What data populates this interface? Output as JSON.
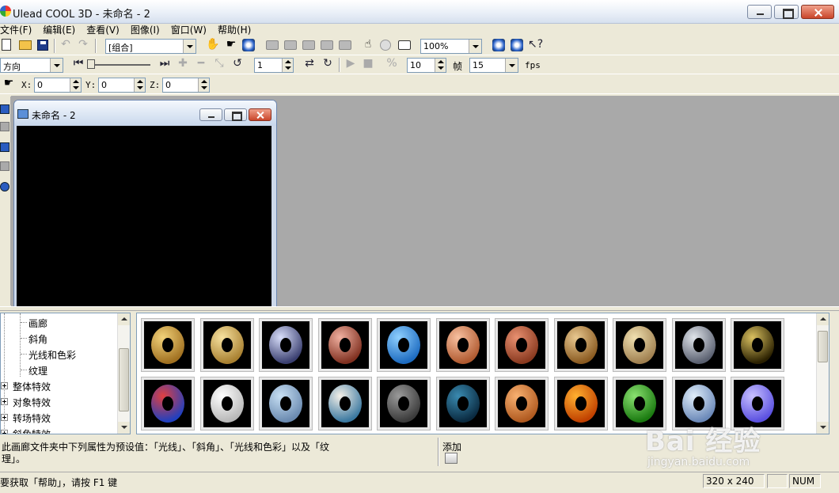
{
  "window": {
    "title": "Ulead COOL 3D - 未命名 - 2"
  },
  "menu": {
    "items": [
      "文件(F)",
      "编辑(E)",
      "查看(V)",
      "图像(I)",
      "窗口(W)",
      "帮助(H)"
    ]
  },
  "toolbar1": {
    "object_combo": "[组合]",
    "zoom_combo": "100%"
  },
  "toolbar2": {
    "direction_combo": "方向",
    "step_value": "1",
    "frame_value": "10",
    "frame_label": "帧",
    "fps_value": "15",
    "fps_label": "fps"
  },
  "toolbar3": {
    "x_label": "X:",
    "x_value": "0",
    "y_label": "Y:",
    "y_value": "0",
    "z_label": "Z:",
    "z_value": "0"
  },
  "child_window": {
    "title": "未命名 - 2"
  },
  "tree": {
    "items": [
      {
        "label": "画廊",
        "level": 2
      },
      {
        "label": "斜角",
        "level": 2
      },
      {
        "label": "光线和色彩",
        "level": 2
      },
      {
        "label": "纹理",
        "level": 2
      },
      {
        "label": "整体特效",
        "level": 1
      },
      {
        "label": "对象特效",
        "level": 1
      },
      {
        "label": "转场特效",
        "level": 1
      },
      {
        "label": "斜角特效",
        "level": 1
      }
    ]
  },
  "gallery": {
    "thumbnails": [
      {
        "color_a": "#f2d27a",
        "color_b": "#a07020"
      },
      {
        "color_a": "#f7e2a0",
        "color_b": "#a88030"
      },
      {
        "color_a": "#d8defa",
        "color_b": "#3a3f70"
      },
      {
        "color_a": "#f0b0a0",
        "color_b": "#803020"
      },
      {
        "color_a": "#8fd0ff",
        "color_b": "#1d6bc0"
      },
      {
        "color_a": "#f8c0a0",
        "color_b": "#b05a30"
      },
      {
        "color_a": "#e89070",
        "color_b": "#8a3a20"
      },
      {
        "color_a": "#e8c890",
        "color_b": "#8a5a20"
      },
      {
        "color_a": "#f0e0b0",
        "color_b": "#a08050"
      },
      {
        "color_a": "#e0e4ea",
        "color_b": "#5a6070"
      },
      {
        "color_a": "#d9c060",
        "color_b": "#2a2000"
      },
      {
        "color_a": "#e04040",
        "color_b": "#2040c0"
      },
      {
        "color_a": "#ffffff",
        "color_b": "#b8b8b8"
      },
      {
        "color_a": "#c8e0f4",
        "color_b": "#6a8ab0"
      },
      {
        "color_a": "#f4f0e8",
        "color_b": "#3a78a0"
      },
      {
        "color_a": "#9a9a9a",
        "color_b": "#3a3a3a"
      },
      {
        "color_a": "#3a8ab0",
        "color_b": "#0a2a40"
      },
      {
        "color_a": "#f8b070",
        "color_b": "#b05a20"
      },
      {
        "color_a": "#ffb030",
        "color_b": "#c04000"
      },
      {
        "color_a": "#8ae070",
        "color_b": "#1a7a10"
      },
      {
        "color_a": "#e0eefa",
        "color_b": "#6a88b8"
      },
      {
        "color_a": "#c8c0ff",
        "color_b": "#5a50e0"
      }
    ]
  },
  "description": {
    "text_line1": "此画廊文件夹中下列属性为预设值：「光线」、「斜角」、「光线和色彩」以及「纹",
    "text_line2": "理」。",
    "add_label": "添加"
  },
  "watermark": {
    "brand": "Bai 经验",
    "url": "jingyan.baidu.com"
  },
  "statusbar": {
    "help_text": "要获取「帮助」，请按 F1 键",
    "size_text": "320 x 240",
    "num_text": "NUM"
  }
}
